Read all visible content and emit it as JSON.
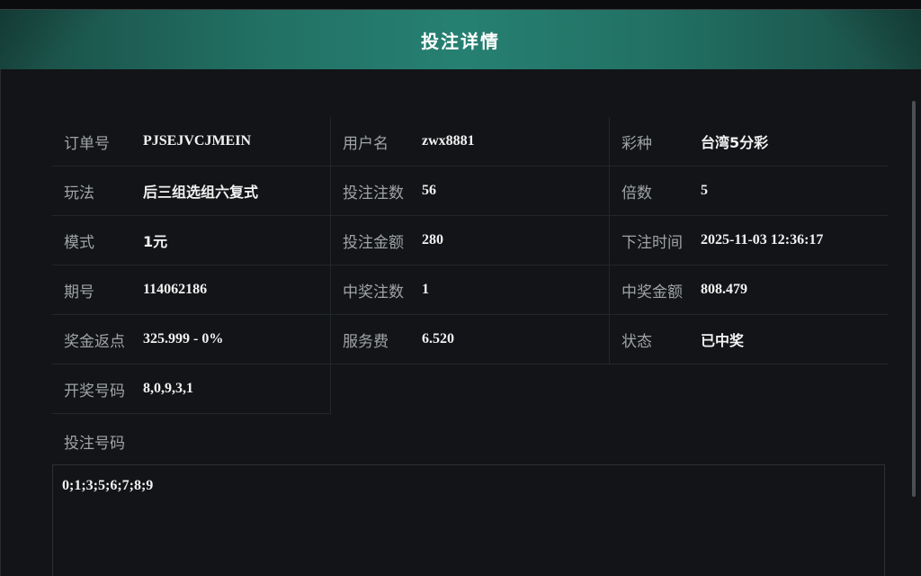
{
  "header": {
    "title": "投注详情"
  },
  "details": {
    "order_no": {
      "label": "订单号",
      "value": "PJSEJVCJMEIN"
    },
    "username": {
      "label": "用户名",
      "value": "zwx8881"
    },
    "lottery": {
      "label": "彩种",
      "value": "台湾5分彩"
    },
    "play": {
      "label": "玩法",
      "value": "后三组选组六复式"
    },
    "bet_count": {
      "label": "投注注数",
      "value": "56"
    },
    "multiple": {
      "label": "倍数",
      "value": "5"
    },
    "mode": {
      "label": "模式",
      "value": "1元"
    },
    "bet_amount": {
      "label": "投注金额",
      "value": "280"
    },
    "bet_time": {
      "label": "下注时间",
      "value": "2025-11-03 12:36:17"
    },
    "issue": {
      "label": "期号",
      "value": "114062186"
    },
    "win_count": {
      "label": "中奖注数",
      "value": "1"
    },
    "win_amount": {
      "label": "中奖金额",
      "value": "808.479"
    },
    "rebate": {
      "label": "奖金返点",
      "value": "325.999 - 0%"
    },
    "service_fee": {
      "label": "服务费",
      "value": "6.520"
    },
    "status": {
      "label": "状态",
      "value": "已中奖"
    },
    "draw_numbers": {
      "label": "开奖号码",
      "value": "8,0,9,3,1"
    }
  },
  "bet_numbers": {
    "label": "投注号码",
    "value": "0;1;3;5;6;7;8;9"
  }
}
